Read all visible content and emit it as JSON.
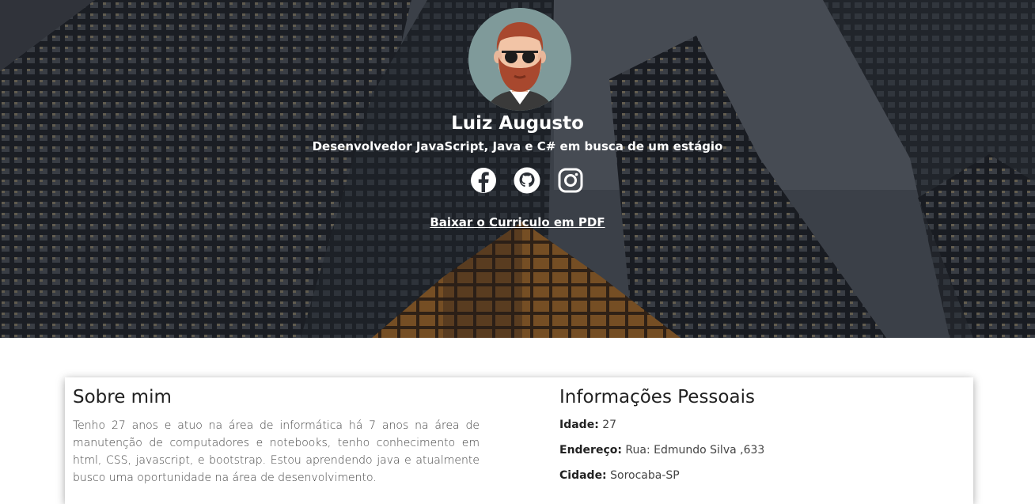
{
  "profile": {
    "name": "Luiz Augusto",
    "tagline": "Desenvolvedor JavaScript, Java e C# em busca de um estágio",
    "cv_link": "Baixar o Curriculo em PDF"
  },
  "socials": [
    {
      "name": "facebook",
      "icon": "facebook-icon"
    },
    {
      "name": "github",
      "icon": "github-icon"
    },
    {
      "name": "instagram",
      "icon": "instagram-icon"
    }
  ],
  "about": {
    "title": "Sobre mim",
    "text": "Tenho 27 anos e atuo na área de informática há 7 anos na área de manutenção de computadores e notebooks, tenho conhecimento em html, CSS, javascript, e bootstrap. Estou aprendendo java e atualmente busco uma oportunidade na área de desenvolvimento."
  },
  "personal_info": {
    "title": "Informações Pessoais",
    "items": [
      {
        "label": "Idade:",
        "value": "27"
      },
      {
        "label": "Endereço:",
        "value": "Rua: Edmundo Silva ,633"
      },
      {
        "label": "Cidade:",
        "value": "Sorocaba-SP"
      }
    ]
  },
  "colors": {
    "hero_overlay": "#2a2e35",
    "avatar_bg": "#7f9a9a",
    "beard": "#a8482e",
    "text_dark": "#222222",
    "text_body": "#444444"
  }
}
